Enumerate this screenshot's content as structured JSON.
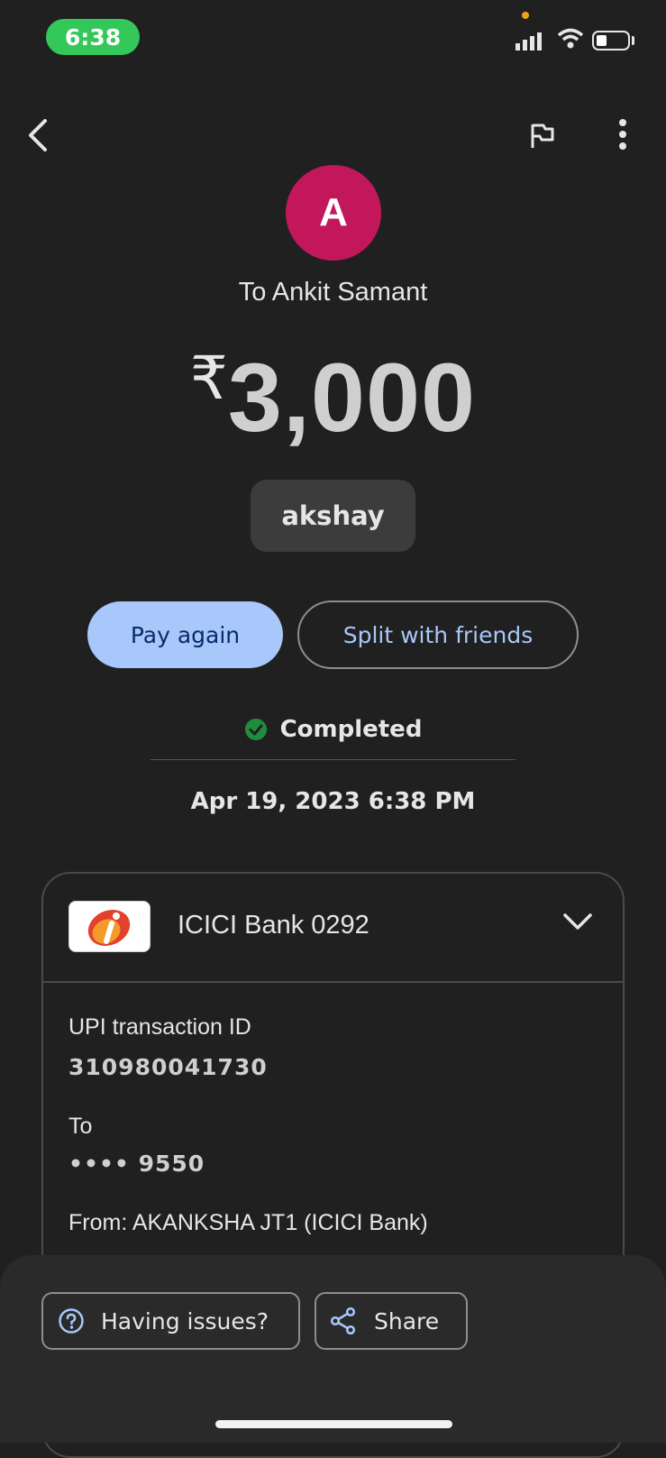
{
  "status_bar": {
    "time": "6:38"
  },
  "transaction": {
    "avatar_letter": "A",
    "recipient": "To Ankit Samant",
    "currency_symbol": "₹",
    "amount": "3,000",
    "note": "akshay",
    "status": "Completed",
    "datetime": "Apr 19, 2023 6:38 PM"
  },
  "actions": {
    "pay_again": "Pay again",
    "split": "Split with friends"
  },
  "details": {
    "bank_name": "ICICI Bank 0292",
    "upi_label": "UPI transaction ID",
    "upi_id": "310980041730",
    "to_label": "To",
    "to_account": "•••• 9550",
    "from_text": "From: AKANKSHA JT1 (ICICI Bank)"
  },
  "bottom": {
    "issues": "Having issues?",
    "share": "Share"
  },
  "colors": {
    "background": "#202020",
    "avatar": "#c2185b",
    "primary_button": "#a8c7fa",
    "success": "#1e8e3e"
  }
}
